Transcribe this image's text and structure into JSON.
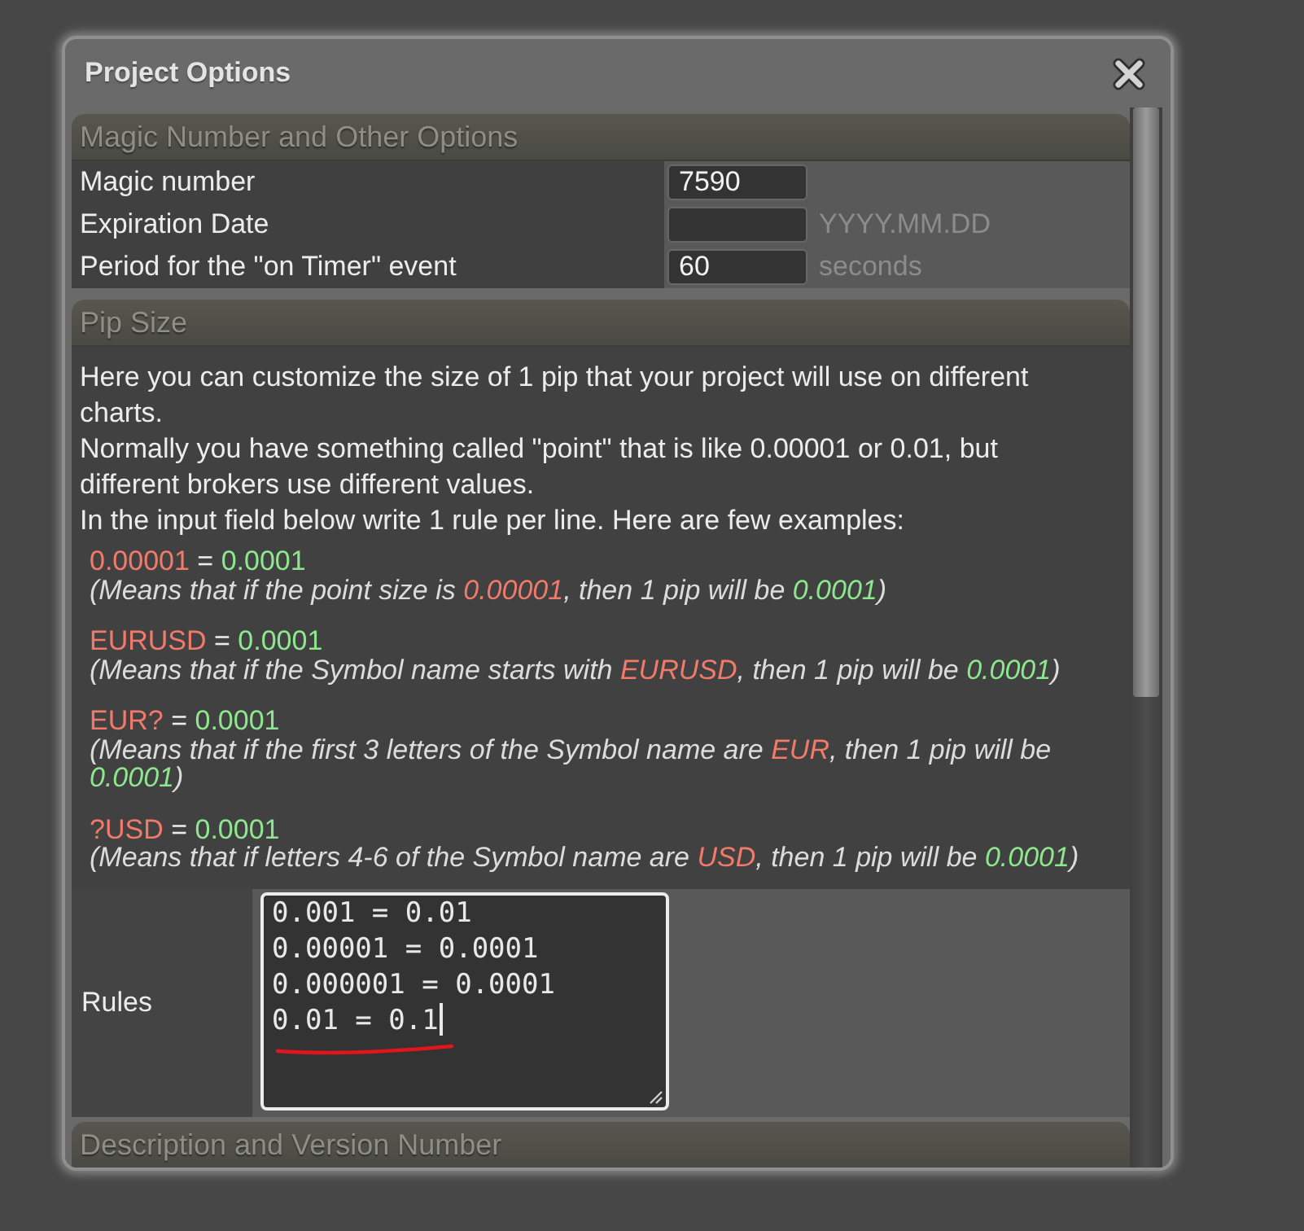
{
  "window": {
    "title": "Project Options"
  },
  "sections": [
    {
      "kind": "fields",
      "title": "Magic Number and Other Options",
      "fields": [
        {
          "label": "Magic number",
          "value": "7590"
        },
        {
          "label": "Expiration Date",
          "hint": "YYYY.MM.DD"
        },
        {
          "label": "Period for the \"on Timer\" event",
          "value": "60",
          "hint": "seconds"
        }
      ]
    },
    {
      "kind": "pip",
      "title": "Pip Size",
      "paragraphs": [
        "Here you can customize the size of 1 pip that your project will use on different charts.",
        "Normally you have something called \"point\" that is like 0.00001 or 0.01, but different brokers use different values.",
        "In the input field below write 1 rule per line. Here are few examples:"
      ],
      "examples": [
        {
          "rule": [
            {
              "text": "0.00001",
              "kind": "pattern"
            },
            {
              "text": " = ",
              "kind": "plain"
            },
            {
              "text": "0.0001",
              "kind": "value"
            }
          ],
          "explanation": [
            {
              "text": "(Means that if the point size is ",
              "kind": "plain"
            },
            {
              "text": "0.00001",
              "kind": "pattern"
            },
            {
              "text": ", then 1 pip will be ",
              "kind": "plain"
            },
            {
              "text": "0.0001",
              "kind": "value"
            },
            {
              "text": ")",
              "kind": "plain"
            }
          ]
        },
        {
          "rule": [
            {
              "text": "EURUSD",
              "kind": "pattern"
            },
            {
              "text": " = ",
              "kind": "plain"
            },
            {
              "text": "0.0001",
              "kind": "value"
            }
          ],
          "explanation": [
            {
              "text": "(Means that if the Symbol name starts with ",
              "kind": "plain"
            },
            {
              "text": "EURUSD",
              "kind": "pattern"
            },
            {
              "text": ", then 1 pip will be ",
              "kind": "plain"
            },
            {
              "text": "0.0001",
              "kind": "value"
            },
            {
              "text": ")",
              "kind": "plain"
            }
          ]
        },
        {
          "rule": [
            {
              "text": "EUR?",
              "kind": "pattern"
            },
            {
              "text": " = ",
              "kind": "plain"
            },
            {
              "text": "0.0001",
              "kind": "value"
            }
          ],
          "explanation": [
            {
              "text": "(Means that if the first 3 letters of the Symbol name are ",
              "kind": "plain"
            },
            {
              "text": "EUR",
              "kind": "pattern"
            },
            {
              "text": ", then 1 pip will be ",
              "kind": "plain"
            },
            {
              "text": "0.0001",
              "kind": "value"
            },
            {
              "text": ")",
              "kind": "plain"
            }
          ]
        },
        {
          "rule": [
            {
              "text": "?USD",
              "kind": "pattern"
            },
            {
              "text": " = ",
              "kind": "plain"
            },
            {
              "text": "0.0001",
              "kind": "value"
            }
          ],
          "explanation": [
            {
              "text": "(Means that if letters 4-6 of the Symbol name are ",
              "kind": "plain"
            },
            {
              "text": "USD",
              "kind": "pattern"
            },
            {
              "text": ", then 1 pip will be ",
              "kind": "plain"
            },
            {
              "text": "0.0001",
              "kind": "value"
            },
            {
              "text": ")",
              "kind": "plain"
            }
          ]
        }
      ],
      "rules_field": {
        "label": "Rules",
        "lines": [
          {
            "text": "0.001 = 0.01",
            "underlined": false,
            "cursor": false
          },
          {
            "text": "0.00001 = 0.0001",
            "underlined": false,
            "cursor": false
          },
          {
            "text": "0.000001 = 0.0001",
            "underlined": false,
            "cursor": false
          },
          {
            "text": "0.01 = 0.1",
            "underlined": true,
            "cursor": true
          }
        ]
      }
    },
    {
      "kind": "header",
      "title": "Description and Version Number"
    }
  ]
}
